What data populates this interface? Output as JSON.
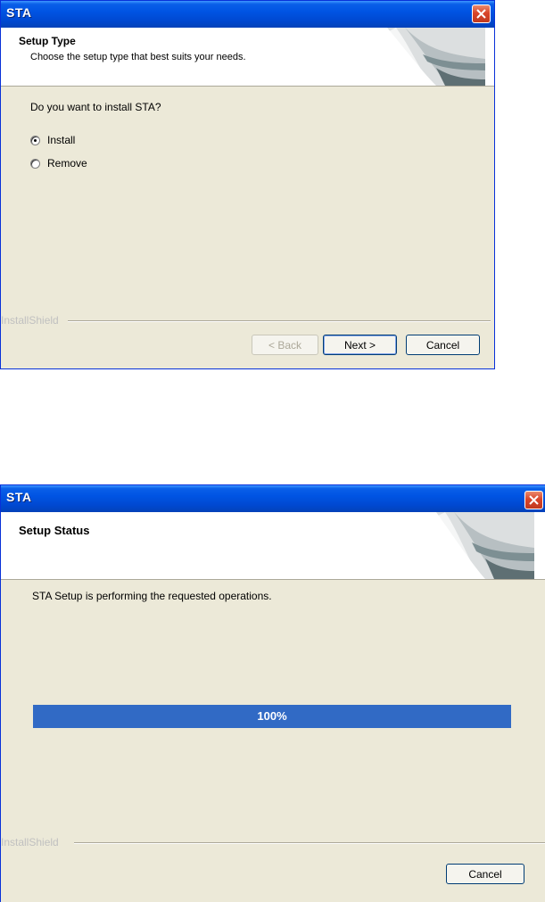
{
  "setup_type_dialog": {
    "title": "STA",
    "header": {
      "title": "Setup Type",
      "subtitle": "Choose the setup type that best suits your needs."
    },
    "prompt": "Do you want to install STA?",
    "options": [
      {
        "label": "Install",
        "selected": true
      },
      {
        "label": "Remove",
        "selected": false
      }
    ],
    "brand": "InstallShield",
    "buttons": {
      "back": "< Back",
      "next": "Next >",
      "cancel": "Cancel"
    }
  },
  "setup_status_dialog": {
    "title": "STA",
    "header": {
      "title": "Setup Status"
    },
    "status_text": "STA Setup is performing the requested operations.",
    "progress": {
      "percent": 100,
      "label": "100%"
    },
    "brand": "InstallShield",
    "buttons": {
      "cancel": "Cancel"
    }
  },
  "colors": {
    "titlebar": "#0054e3",
    "dialog_bg": "#ece9d8",
    "progress_fill": "#316ac5",
    "close_button": "#d9452a"
  },
  "icons": [
    "close-icon",
    "installshield-header-graphic"
  ]
}
